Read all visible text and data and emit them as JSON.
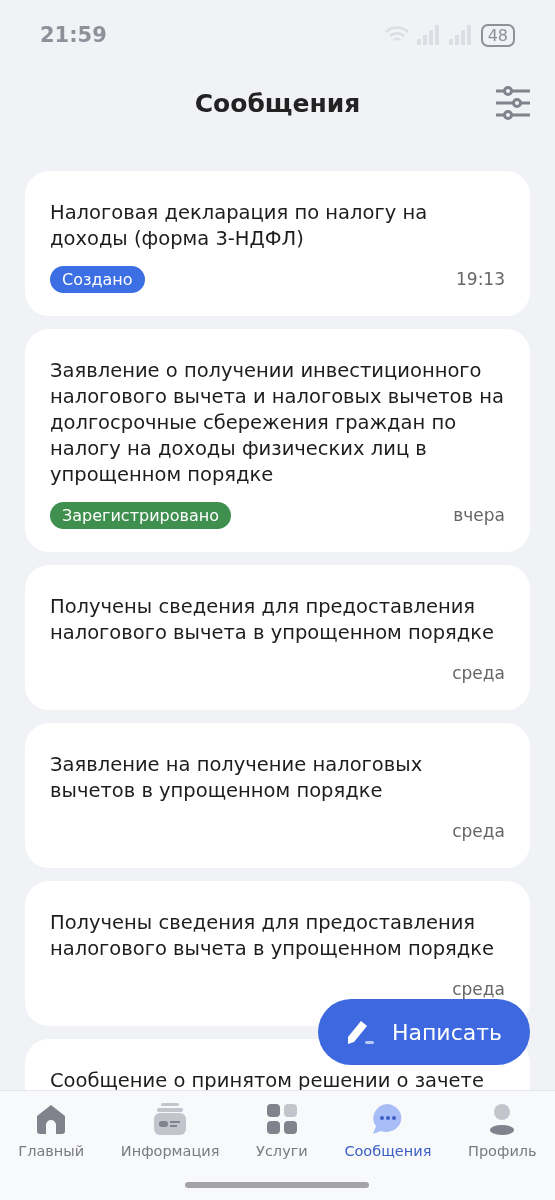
{
  "status_bar": {
    "time": "21:59",
    "battery": "48"
  },
  "header": {
    "title": "Сообщения"
  },
  "messages": [
    {
      "title": "Налоговая декларация по налогу на доходы (форма 3-НДФЛ)",
      "badge": {
        "label": "Создано",
        "color": "#3d6fe4"
      },
      "time": "19:13"
    },
    {
      "title": "Заявление о получении инвестиционного налогового вычета и налоговых вычетов на долгосрочные сбережения граждан по налогу на доходы физических лиц в упрощенном порядке",
      "badge": {
        "label": "Зарегистрировано",
        "color": "#3f8f4f"
      },
      "time": "вчера"
    },
    {
      "title": "Получены сведения для предоставления налогового вычета в упрощенном порядке",
      "time": "среда"
    },
    {
      "title": "Заявление на получение налоговых вычетов в упрощенном порядке",
      "time": "среда"
    },
    {
      "title": "Получены сведения для предоставления налогового вычета в упрощенном порядке",
      "time": "среда"
    },
    {
      "title": "Сообщение о принятом решении о зачете"
    }
  ],
  "fab": {
    "label": "Написать"
  },
  "nav": [
    {
      "label": "Главный",
      "selected": false
    },
    {
      "label": "Информация",
      "selected": false
    },
    {
      "label": "Услуги",
      "selected": false
    },
    {
      "label": "Сообщения",
      "selected": true
    },
    {
      "label": "Профиль",
      "selected": false
    }
  ]
}
